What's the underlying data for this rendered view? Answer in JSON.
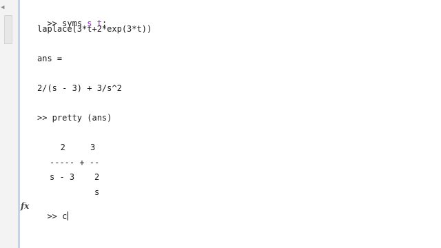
{
  "console": {
    "lines": [
      {
        "prompt": ">>",
        "cmd_pre": "syms ",
        "kw1": "s",
        "kw2": "t",
        "cmd_post": ";"
      },
      {
        "text": "laplace(3*t+2*exp(3*t))"
      },
      {
        "text": "ans ="
      },
      {
        "text": "2/(s - 3) + 3/s^2"
      },
      {
        "text": ">> pretty (ans)"
      }
    ],
    "pretty_output": {
      "row1": "   2     3",
      "row2": "----- + --",
      "row3": "s - 3    2",
      "row4": "         s"
    },
    "current_input": ">> c"
  },
  "icons": {
    "fx": "fx"
  }
}
